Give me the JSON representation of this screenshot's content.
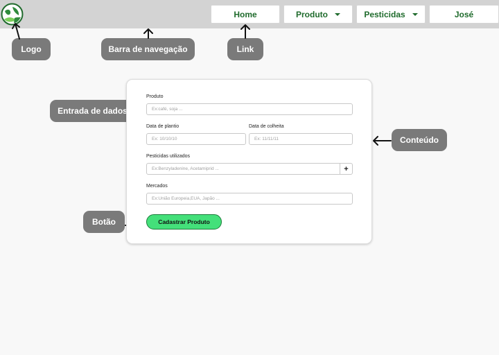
{
  "nav": {
    "items": [
      {
        "label": "Home"
      },
      {
        "label": "Produto"
      },
      {
        "label": "Pesticidas"
      },
      {
        "label": "José"
      }
    ]
  },
  "form": {
    "produto": {
      "label": "Produto",
      "placeholder": "Ex:café, soja ..."
    },
    "data_plantio": {
      "label": "Data de plantio",
      "placeholder": "Ex: 10/10/10"
    },
    "data_colheita": {
      "label": "Data de colheita",
      "placeholder": "Ex: 11/11/11"
    },
    "pesticidas": {
      "label": "Pesticidas utilizados",
      "placeholder": "Ex:Benzyladenine, Acetamiprid ...",
      "add_label": "+"
    },
    "mercados": {
      "label": "Mercados",
      "placeholder": "Ex:União Europeia,EUA, Japão ..."
    },
    "submit_label": "Cadastrar Produto"
  },
  "annotations": {
    "logo": "Logo",
    "navbar": "Barra de navegação",
    "link": "Link",
    "entrada": "Entrada de dados",
    "conteudo": "Conteúdo",
    "botao": "Botão"
  },
  "colors": {
    "nav_bg": "#d3d3d3",
    "nav_text": "#1f6b2c",
    "callout_bg": "#7a7a7a",
    "submit_bg": "#44e07a"
  }
}
